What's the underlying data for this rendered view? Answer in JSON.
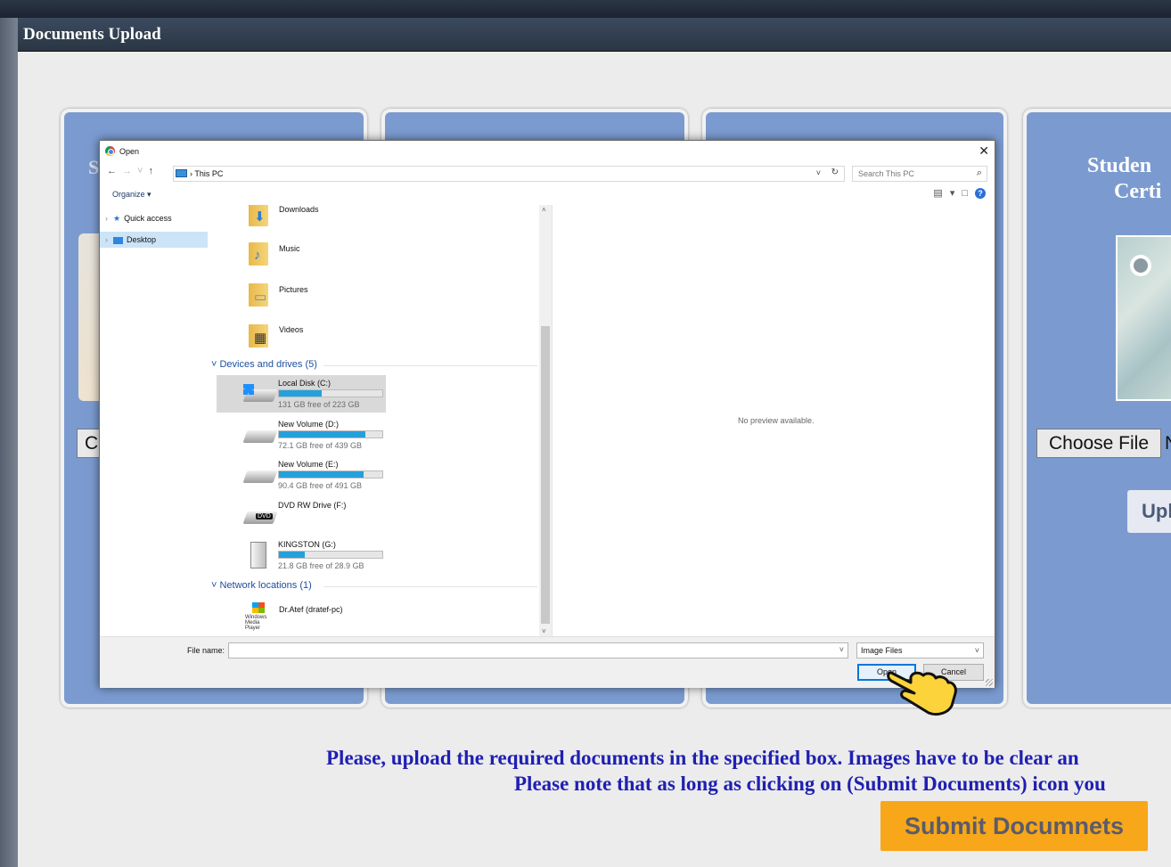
{
  "window": {
    "title": "Documents Upload"
  },
  "card4": {
    "title_line1": "Studen",
    "title_line2": "Certi",
    "choose_file_label": "Choose File",
    "choose_file_suffix": "N",
    "upload_label": "Upl"
  },
  "card1": {
    "letter": "S",
    "choose_file_stub": "C"
  },
  "dialog": {
    "title": "Open",
    "close_glyph": "✕",
    "address_path": "This PC",
    "search_placeholder": "Search This PC",
    "organize_label": "Organize ▾",
    "nav": [
      {
        "label": "Quick access"
      },
      {
        "label": "Desktop"
      }
    ],
    "folders": [
      {
        "label": "Downloads"
      },
      {
        "label": "Music"
      },
      {
        "label": "Pictures"
      },
      {
        "label": "Videos"
      }
    ],
    "devices_header": "Devices and drives (5)",
    "drives": [
      {
        "name": "Local Disk (C:)",
        "free": "131 GB free of 223 GB",
        "used_fraction": 0.41
      },
      {
        "name": "New Volume (D:)",
        "free": "72.1 GB free of 439 GB",
        "used_fraction": 0.84
      },
      {
        "name": "New Volume (E:)",
        "free": "90.4 GB free of 491 GB",
        "used_fraction": 0.82
      },
      {
        "name": "DVD RW Drive (F:)",
        "free": "",
        "used_fraction": null
      },
      {
        "name": "KINGSTON (G:)",
        "free": "21.8 GB free of 28.9 GB",
        "used_fraction": 0.25
      }
    ],
    "dvd_badge": "DVD",
    "network_header": "Network locations (1)",
    "network": [
      {
        "name": "Dr.Atef (dratef-pc)",
        "icon_caption": "Windows Media Player"
      }
    ],
    "preview_text": "No preview available.",
    "filename_label": "File name:",
    "filename_value": "",
    "filter_value": "Image Files",
    "open_label": "Open",
    "cancel_label": "Cancel"
  },
  "instructions": {
    "line1": "Please, upload the required documents in the specified box. Images have to be clear an",
    "line2": "Please note that as long as clicking on (Submit Documents) icon you"
  },
  "submit_label": "Submit Documnets",
  "colors": {
    "card": "#7b9bd0",
    "submit": "#f7a719",
    "instructions": "#1f1fb3",
    "drive_bar": "#26a0da"
  }
}
